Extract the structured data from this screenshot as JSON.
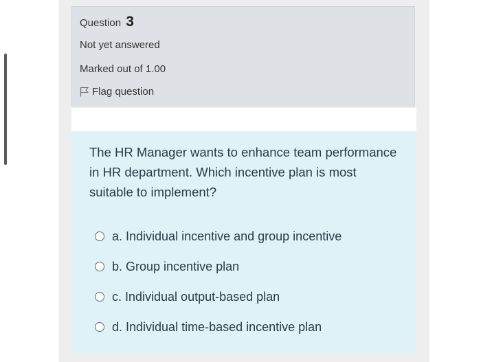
{
  "question": {
    "label": "Question",
    "number": "3",
    "state": "Not yet answered",
    "grade": "Marked out of 1.00",
    "flag_label": "Flag question",
    "flag_icon": "flag-icon",
    "text": "The HR Manager wants to enhance team performance in HR department. Which incentive plan is most suitable to implement?",
    "options": [
      {
        "label": "a. Individual incentive and group incentive",
        "selected": false
      },
      {
        "label": "b. Group incentive plan",
        "selected": false
      },
      {
        "label": "c. Individual output-based plan",
        "selected": false
      },
      {
        "label": "d. Individual time-based incentive plan",
        "selected": false
      }
    ]
  },
  "colors": {
    "info_background": "#dee2e6",
    "content_background": "#def2f8",
    "text": "#2b3a45"
  }
}
